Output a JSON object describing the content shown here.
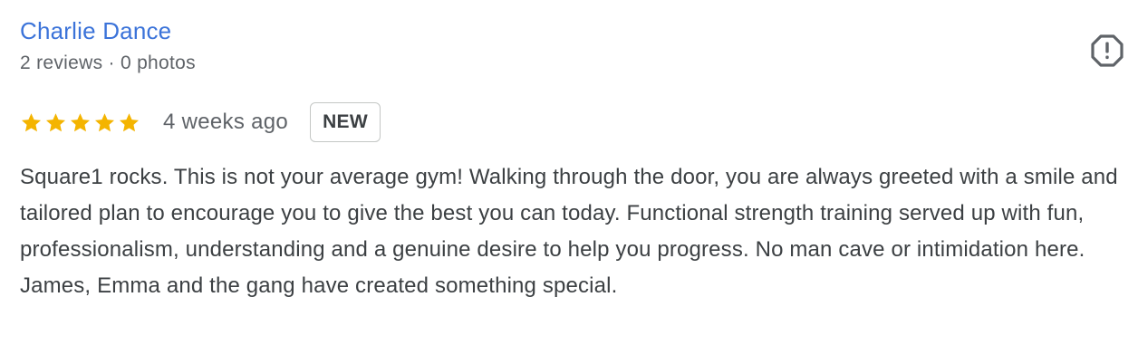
{
  "reviewer": {
    "name": "Charlie Dance",
    "meta": "2 reviews · 0 photos"
  },
  "rating": {
    "stars": 5,
    "max_stars": 5,
    "star_color": "#f4b400"
  },
  "time_ago": "4 weeks ago",
  "badge": "NEW",
  "review_text": "Square1 rocks. This is not your average gym! Walking through the door, you are always greeted with a smile and tailored plan to encourage you to give the best you can today. Functional strength training served up with fun, professionalism, understanding and a genuine desire to help you progress. No man cave or intimidation here. James, Emma and the gang have created something special.",
  "icons": {
    "report": "report-octagon-icon",
    "star": "star-icon"
  },
  "colors": {
    "name_link": "#3b73d9",
    "meta_text": "#5f6368",
    "body_text": "#3c4043"
  }
}
